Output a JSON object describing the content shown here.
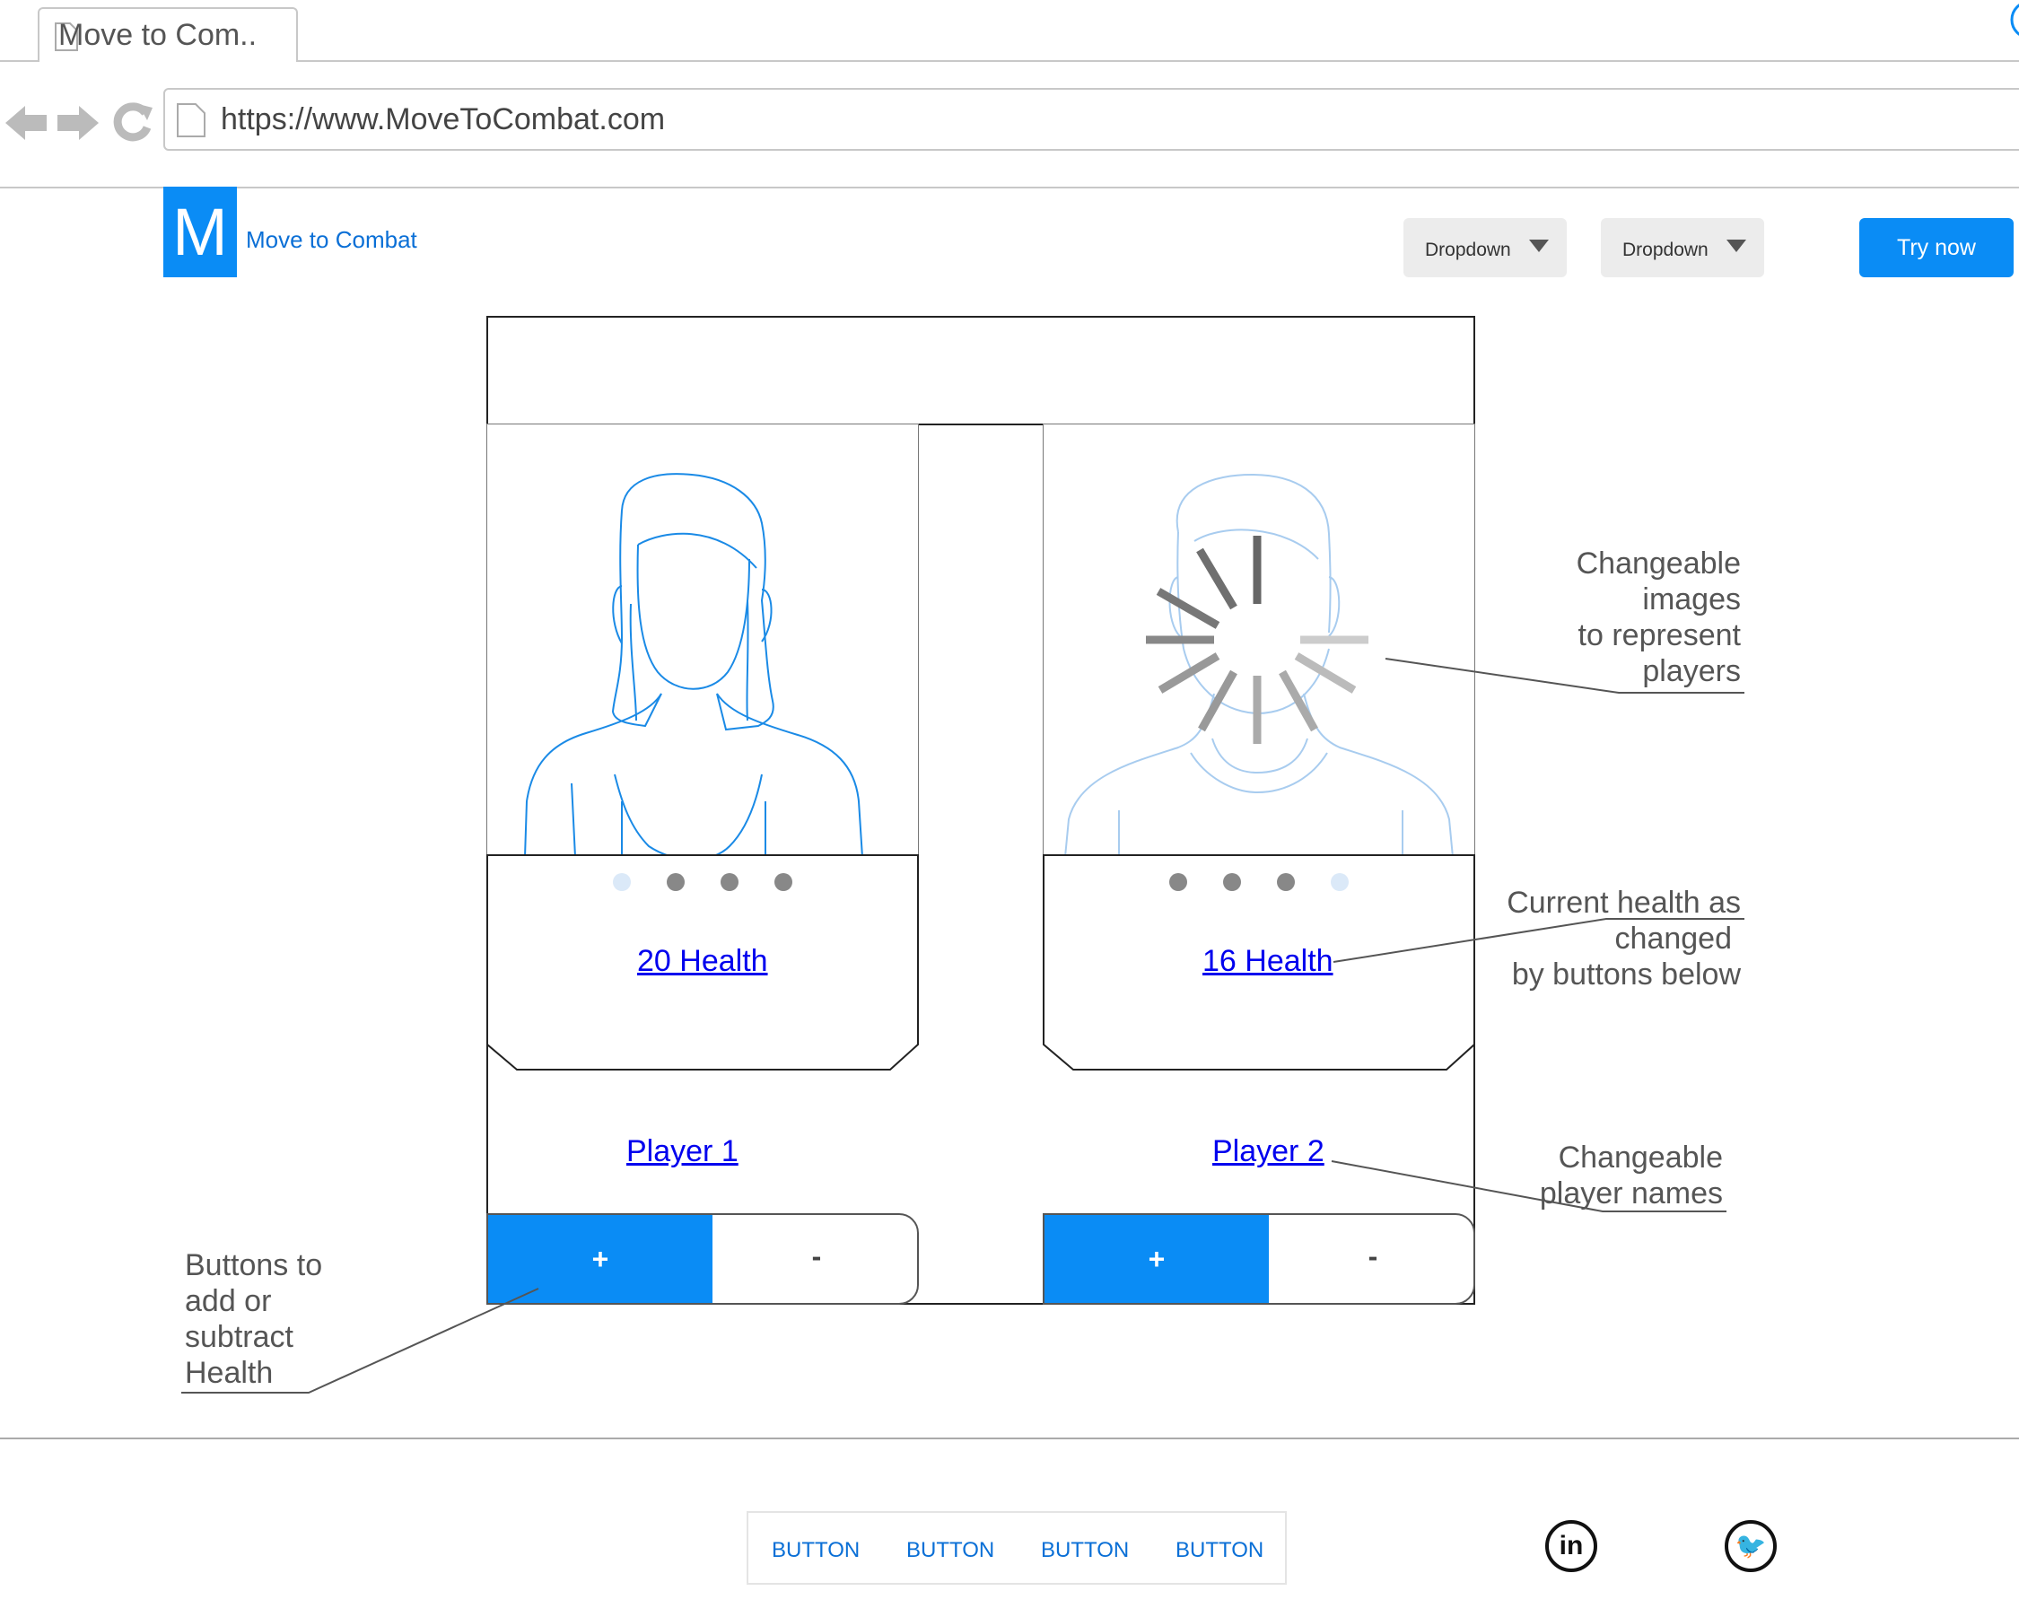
{
  "browser": {
    "tab_title": "Move to Com..",
    "url": "https://www.MoveToCombat.com"
  },
  "header": {
    "logo_letter": "M",
    "brand": "Move to Combat",
    "dropdowns": [
      {
        "label": "Dropdown"
      },
      {
        "label": "Dropdown"
      }
    ],
    "cta_label": "Try now"
  },
  "players": [
    {
      "name": "Player 1",
      "health": "20 Health",
      "plus_label": "+",
      "minus_label": "-"
    },
    {
      "name": "Player 2",
      "health": "16 Health",
      "plus_label": "+",
      "minus_label": "-"
    }
  ],
  "annotations": {
    "images": [
      "Changeable",
      "images",
      "to represent",
      "players"
    ],
    "health": [
      "Current health as",
      "changed",
      "by buttons below"
    ],
    "names": [
      "Changeable",
      "player names"
    ],
    "buttons": [
      "Buttons to",
      "add or",
      "subtract",
      "Health"
    ]
  },
  "footer": {
    "nav": [
      "BUTTON",
      "BUTTON",
      "BUTTON",
      "BUTTON"
    ],
    "social": [
      {
        "icon": "linkedin-icon",
        "glyph": "in"
      },
      {
        "icon": "twitter-icon",
        "glyph": "🐦"
      }
    ]
  },
  "colors": {
    "accent": "#0a8cf5",
    "link": "#0000ee",
    "portrait_line": "#1a8ae6"
  }
}
